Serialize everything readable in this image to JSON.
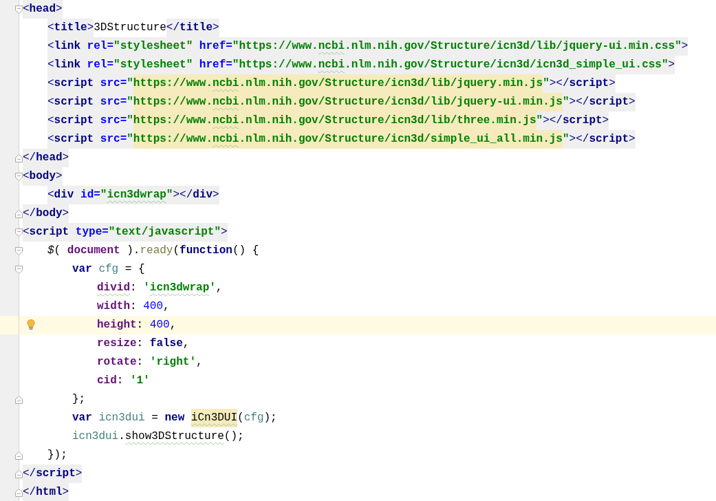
{
  "editor": {
    "lines": [
      {
        "kind": "open",
        "current": false,
        "tokens": [
          {
            "kind": "br",
            "text": "<"
          },
          {
            "kind": "tag",
            "text": "head"
          },
          {
            "kind": "br",
            "text": ">"
          }
        ],
        "children": [
          {
            "current": false,
            "tokens": [
              {
                "kind": "br",
                "text": "<"
              },
              {
                "kind": "tag",
                "text": "title"
              },
              {
                "kind": "br",
                "text": ">"
              },
              {
                "kind": "text",
                "text": "3DStructure"
              },
              {
                "kind": "br",
                "text": "</"
              },
              {
                "kind": "tag",
                "text": "title"
              },
              {
                "kind": "br",
                "text": ">"
              }
            ]
          },
          {
            "current": false,
            "tokens": [
              {
                "kind": "br",
                "text": "<"
              },
              {
                "kind": "tag",
                "text": "link"
              },
              {
                "kind": "attr",
                "text": " rel="
              },
              {
                "kind": "value",
                "text": "\"stylesheet\""
              },
              {
                "kind": "attr",
                "text": " href="
              },
              {
                "kind": "value",
                "text": "\"https://www."
              },
              {
                "kind": "value",
                "text": "ncbi",
                "typo": true
              },
              {
                "kind": "value",
                "text": ".nlm.nih.gov/Structure/icn3d/lib/jquery-ui.min.css\""
              },
              {
                "kind": "br",
                "text": ">"
              }
            ]
          },
          {
            "current": false,
            "tokens": [
              {
                "kind": "br",
                "text": "<"
              },
              {
                "kind": "tag",
                "text": "link"
              },
              {
                "kind": "attr",
                "text": " rel="
              },
              {
                "kind": "value",
                "text": "\"stylesheet\""
              },
              {
                "kind": "attr",
                "text": " href="
              },
              {
                "kind": "value",
                "text": "\"https://www."
              },
              {
                "kind": "value",
                "text": "ncbi",
                "typo": true
              },
              {
                "kind": "value",
                "text": ".nlm.nih.gov/Structure/icn3d/icn3d_simple_ui.css\""
              },
              {
                "kind": "br",
                "text": ">"
              }
            ]
          },
          {
            "current": false,
            "tokens": [
              {
                "kind": "br",
                "text": "<"
              },
              {
                "kind": "tag",
                "text": "script"
              },
              {
                "kind": "attr",
                "text": " src="
              },
              {
                "kind": "value",
                "text": "\""
              },
              {
                "kind": "url",
                "text": "https://www."
              },
              {
                "kind": "url",
                "text": "ncbi",
                "typo": true
              },
              {
                "kind": "url",
                "text": ".nlm.nih.gov/Structure/icn3d/lib/jquery.min.js"
              },
              {
                "kind": "value",
                "text": "\""
              },
              {
                "kind": "br",
                "text": "></"
              },
              {
                "kind": "tag",
                "text": "script"
              },
              {
                "kind": "br",
                "text": ">"
              }
            ]
          },
          {
            "current": false,
            "tokens": [
              {
                "kind": "br",
                "text": "<"
              },
              {
                "kind": "tag",
                "text": "script"
              },
              {
                "kind": "attr",
                "text": " src="
              },
              {
                "kind": "value",
                "text": "\""
              },
              {
                "kind": "url",
                "text": "https://www."
              },
              {
                "kind": "url",
                "text": "ncbi",
                "typo": true
              },
              {
                "kind": "url",
                "text": ".nlm.nih.gov/Structure/icn3d/lib/jquery-ui.min.js"
              },
              {
                "kind": "value",
                "text": "\""
              },
              {
                "kind": "br",
                "text": "></"
              },
              {
                "kind": "tag",
                "text": "script"
              },
              {
                "kind": "br",
                "text": ">"
              }
            ]
          },
          {
            "current": false,
            "tokens": [
              {
                "kind": "br",
                "text": "<"
              },
              {
                "kind": "tag",
                "text": "script"
              },
              {
                "kind": "attr",
                "text": " src="
              },
              {
                "kind": "value",
                "text": "\""
              },
              {
                "kind": "url",
                "text": "https://www."
              },
              {
                "kind": "url",
                "text": "ncbi",
                "typo": true
              },
              {
                "kind": "url",
                "text": ".nlm.nih.gov/Structure/icn3d/lib/three.min.js"
              },
              {
                "kind": "value",
                "text": "\""
              },
              {
                "kind": "br",
                "text": "></"
              },
              {
                "kind": "tag",
                "text": "script"
              },
              {
                "kind": "br",
                "text": ">"
              }
            ]
          },
          {
            "current": false,
            "tokens": [
              {
                "kind": "br",
                "text": "<"
              },
              {
                "kind": "tag",
                "text": "script"
              },
              {
                "kind": "attr",
                "text": " src="
              },
              {
                "kind": "value",
                "text": "\""
              },
              {
                "kind": "url",
                "text": "https://www."
              },
              {
                "kind": "url",
                "text": "ncbi",
                "typo": true
              },
              {
                "kind": "url",
                "text": ".nlm.nih.gov/Structure/icn3d/simple_ui_all.min.js"
              },
              {
                "kind": "value",
                "text": "\""
              },
              {
                "kind": "br",
                "text": "></"
              },
              {
                "kind": "tag",
                "text": "script"
              },
              {
                "kind": "br",
                "text": ">"
              }
            ]
          }
        ]
      },
      {
        "kind": "close",
        "current": false,
        "tokens": [
          {
            "kind": "br",
            "text": "</"
          },
          {
            "kind": "tag",
            "text": "head"
          },
          {
            "kind": "br",
            "text": ">"
          }
        ]
      },
      {
        "kind": "open",
        "current": false,
        "tokens": [
          {
            "kind": "br",
            "text": "<"
          },
          {
            "kind": "tag",
            "text": "body"
          },
          {
            "kind": "br",
            "text": ">"
          }
        ],
        "children": [
          {
            "current": false,
            "tokens": [
              {
                "kind": "br",
                "text": "<"
              },
              {
                "kind": "tag",
                "text": "div"
              },
              {
                "kind": "attr",
                "text": " id="
              },
              {
                "kind": "value",
                "text": "\""
              },
              {
                "kind": "value",
                "text": "icn3dwrap",
                "typo": true
              },
              {
                "kind": "value",
                "text": "\""
              },
              {
                "kind": "br",
                "text": "></"
              },
              {
                "kind": "tag",
                "text": "div"
              },
              {
                "kind": "br",
                "text": ">"
              }
            ]
          }
        ]
      },
      {
        "kind": "close",
        "current": false,
        "tokens": [
          {
            "kind": "br",
            "text": "</"
          },
          {
            "kind": "tag",
            "text": "body"
          },
          {
            "kind": "br",
            "text": ">"
          }
        ]
      },
      {
        "kind": "open",
        "current": false,
        "tokens": [
          {
            "kind": "br",
            "text": "<"
          },
          {
            "kind": "tag",
            "text": "script"
          },
          {
            "kind": "attr",
            "text": " type="
          },
          {
            "kind": "value",
            "text": "\"text/javascript\""
          },
          {
            "kind": "br",
            "text": ">"
          }
        ],
        "children": [
          {
            "kind": "open",
            "current": false,
            "tokens": [
              {
                "kind": "dollar",
                "text": "$"
              },
              {
                "kind": "punct",
                "text": "( "
              },
              {
                "kind": "doc",
                "text": "document"
              },
              {
                "kind": "punct",
                "text": " )."
              },
              {
                "kind": "method",
                "text": "ready"
              },
              {
                "kind": "punct",
                "text": "("
              },
              {
                "kind": "kw",
                "text": "function"
              },
              {
                "kind": "punct",
                "text": "() {"
              }
            ],
            "children": [
              {
                "kind": "open",
                "current": false,
                "tokens": [
                  {
                    "kind": "kw",
                    "text": "var "
                  },
                  {
                    "kind": "ident",
                    "text": "cfg"
                  },
                  {
                    "kind": "punct",
                    "text": " = {"
                  }
                ],
                "children": [
                  {
                    "current": false,
                    "tokens": [
                      {
                        "kind": "prop",
                        "text": "divid",
                        "typo": true
                      },
                      {
                        "kind": "punct",
                        "text": ": "
                      },
                      {
                        "kind": "str",
                        "text": "'"
                      },
                      {
                        "kind": "str",
                        "text": "icn3dwrap",
                        "typo": true
                      },
                      {
                        "kind": "str",
                        "text": "'"
                      },
                      {
                        "kind": "punct",
                        "text": ","
                      }
                    ]
                  },
                  {
                    "current": false,
                    "tokens": [
                      {
                        "kind": "prop",
                        "text": "width"
                      },
                      {
                        "kind": "punct",
                        "text": ": "
                      },
                      {
                        "kind": "num",
                        "text": "400"
                      },
                      {
                        "kind": "punct",
                        "text": ","
                      }
                    ]
                  },
                  {
                    "current": true,
                    "tokens": [
                      {
                        "kind": "prop",
                        "text": "height"
                      },
                      {
                        "kind": "punct",
                        "text": ": "
                      },
                      {
                        "kind": "num",
                        "text": "400"
                      },
                      {
                        "kind": "punct",
                        "text": ","
                      }
                    ]
                  },
                  {
                    "current": false,
                    "tokens": [
                      {
                        "kind": "prop",
                        "text": "resize"
                      },
                      {
                        "kind": "punct",
                        "text": ": "
                      },
                      {
                        "kind": "kw",
                        "text": "false"
                      },
                      {
                        "kind": "punct",
                        "text": ","
                      }
                    ]
                  },
                  {
                    "current": false,
                    "tokens": [
                      {
                        "kind": "prop",
                        "text": "rotate"
                      },
                      {
                        "kind": "punct",
                        "text": ": "
                      },
                      {
                        "kind": "str",
                        "text": "'right'"
                      },
                      {
                        "kind": "punct",
                        "text": ","
                      }
                    ]
                  },
                  {
                    "current": false,
                    "tokens": [
                      {
                        "kind": "prop",
                        "text": "cid"
                      },
                      {
                        "kind": "punct",
                        "text": ": "
                      },
                      {
                        "kind": "str",
                        "text": "'1'"
                      }
                    ]
                  }
                ]
              },
              {
                "kind": "close",
                "current": false,
                "tokens": [
                  {
                    "kind": "punct",
                    "text": "};"
                  }
                ]
              },
              {
                "current": false,
                "tokens": [
                  {
                    "kind": "kw",
                    "text": "var "
                  },
                  {
                    "kind": "ident",
                    "text": "icn3dui"
                  },
                  {
                    "kind": "punct",
                    "text": " = "
                  },
                  {
                    "kind": "kw",
                    "text": "new "
                  },
                  {
                    "kind": "cls",
                    "text": "iCn3DUI",
                    "typo": true
                  },
                  {
                    "kind": "punct",
                    "text": "("
                  },
                  {
                    "kind": "ident",
                    "text": "cfg"
                  },
                  {
                    "kind": "punct",
                    "text": ");"
                  }
                ]
              },
              {
                "current": false,
                "tokens": [
                  {
                    "kind": "ident",
                    "text": "icn3dui"
                  },
                  {
                    "kind": "punct",
                    "text": "."
                  },
                  {
                    "kind": "fn",
                    "text": "show3DStructure",
                    "typo": true
                  },
                  {
                    "kind": "punct",
                    "text": "();"
                  }
                ]
              }
            ]
          },
          {
            "kind": "close",
            "current": false,
            "tokens": [
              {
                "kind": "punct",
                "text": "});"
              }
            ]
          }
        ]
      },
      {
        "kind": "close",
        "current": false,
        "tokens": [
          {
            "kind": "br",
            "text": "</"
          },
          {
            "kind": "tag",
            "text": "script"
          },
          {
            "kind": "br",
            "text": ">"
          }
        ]
      },
      {
        "kind": "close",
        "current": false,
        "tokens": [
          {
            "kind": "br",
            "text": "</"
          },
          {
            "kind": "tag",
            "text": "html"
          },
          {
            "kind": "br",
            "text": ">"
          }
        ]
      }
    ]
  }
}
